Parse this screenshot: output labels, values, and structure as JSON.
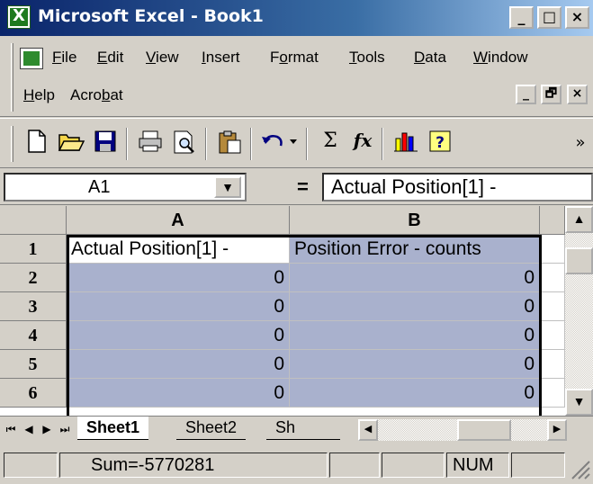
{
  "window": {
    "title": "Microsoft Excel - Book1",
    "min_label": "_",
    "max_label": "□",
    "close_label": "×"
  },
  "menu": {
    "items": [
      {
        "pre": "",
        "u": "F",
        "post": "ile"
      },
      {
        "pre": "",
        "u": "E",
        "post": "dit"
      },
      {
        "pre": "",
        "u": "V",
        "post": "iew"
      },
      {
        "pre": "",
        "u": "I",
        "post": "nsert"
      },
      {
        "pre": "F",
        "u": "o",
        "post": "rmat"
      },
      {
        "pre": "",
        "u": "T",
        "post": "ools"
      },
      {
        "pre": "",
        "u": "D",
        "post": "ata"
      },
      {
        "pre": "",
        "u": "W",
        "post": "indow"
      },
      {
        "pre": "",
        "u": "H",
        "post": "elp"
      },
      {
        "pre": "Acro",
        "u": "b",
        "post": "at"
      }
    ],
    "mdi_min": "_",
    "mdi_restore": "🗗",
    "mdi_close": "×"
  },
  "toolbar": {
    "icons": [
      "new-icon",
      "open-icon",
      "save-icon",
      "print-icon",
      "print-preview-icon",
      "paste-icon",
      "undo-icon",
      "autosum-icon",
      "function-icon",
      "chart-wizard-icon",
      "help-icon",
      "more-icon"
    ],
    "autosum_glyph": "Σ",
    "function_glyph": "fx",
    "more_glyph": "»"
  },
  "formula_bar": {
    "name_box": "A1",
    "equals": "=",
    "content": "Actual Position[1] -"
  },
  "grid": {
    "columns": [
      "A",
      "B"
    ],
    "rows": [
      {
        "num": "1",
        "a": "Actual Position[1] -",
        "b": "Position Error - counts"
      },
      {
        "num": "2",
        "a": "0",
        "b": "0"
      },
      {
        "num": "3",
        "a": "0",
        "b": "0"
      },
      {
        "num": "4",
        "a": "0",
        "b": "0"
      },
      {
        "num": "5",
        "a": "0",
        "b": "0"
      },
      {
        "num": "6",
        "a": "0",
        "b": "0"
      }
    ]
  },
  "sheets": {
    "tabs": [
      "Sheet1",
      "Sheet2",
      "Sh"
    ],
    "active": "Sheet1"
  },
  "status": {
    "sum": "Sum=-5770281",
    "num": "NUM"
  }
}
